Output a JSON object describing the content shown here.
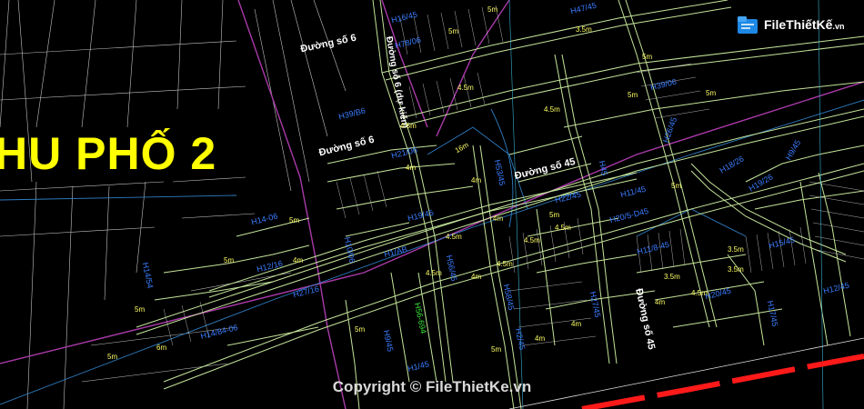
{
  "district_title": "HU PHỐ 2",
  "watermark": {
    "brand": "FileThiếtKế",
    "domain": ".vn",
    "copyright": "Copyright © FileThietKe.vn"
  },
  "road_labels": {
    "duong_so_6_top": "Đường số 6",
    "duong_so_6_duc": "Đường số 6 (dự kiến)",
    "duong_so_6_mid": "Đường số 6",
    "duong_so_45_mid": "Đường số 45",
    "duong_so_45_low": "Đường số 45"
  },
  "parcel_tags": {
    "h16_45": "H16/45",
    "h47_45": "H47/45",
    "h78_06": "H78/06",
    "h39_06": "H39/06",
    "h39_b6": "H39/B6",
    "h21_06": "H21/06",
    "h26_45": "H26/45",
    "h14_06": "H14-06",
    "h14_54": "H14/54",
    "h12_16": "H12/16",
    "h27_16": "H27/16",
    "h10_06": "H10/06",
    "h14_84": "H14/84-06",
    "h19_45": "H19/45",
    "h1_ab": "H1/AB",
    "h56_45": "H56/45",
    "h53_45": "H53/45",
    "h22_45": "H22/45",
    "h58_45": "H58/45",
    "h9_45": "H9/45",
    "h56_green": "H56-694",
    "h1_45": "H1/45",
    "h2_45": "H2/45",
    "h45_a": "H45",
    "h11_45": "H11/45",
    "h20_5": "H20/5-D45",
    "h11_8": "H11/8-45",
    "h18_26": "H18/26",
    "h19_26": "H19/26",
    "h9_45b": "H9/45",
    "h15_45": "H15/45",
    "h12_45": "H12/45",
    "h17_45": "H17/45",
    "h20_45": "H20/45",
    "h27_45": "H27/45"
  },
  "distances": [
    "5m",
    "5m",
    "3.5m",
    "5m",
    "4.5m",
    "4.5m",
    "5m",
    "5m",
    "4.5m",
    "16m",
    "4m",
    "4m",
    "5m",
    "4m",
    "5m",
    "4.5m",
    "4.5m",
    "4.5m",
    "4m",
    "5m",
    "4.5m",
    "4m",
    "4.5m",
    "4.5m",
    "3.5m",
    "3.5m",
    "4m",
    "5m",
    "5m",
    "6m",
    "5m",
    "4m",
    "4m",
    "5m",
    "3.5m",
    "5m"
  ],
  "colors": {
    "background": "#000000",
    "road_edge": "#c8e89a",
    "lot_line": "#ffffff",
    "boundary": "#b03ab0",
    "canal": "#3a8fd0",
    "tag": "#3a7cff",
    "title": "#ffff00",
    "rail": "#ff1a1a"
  }
}
